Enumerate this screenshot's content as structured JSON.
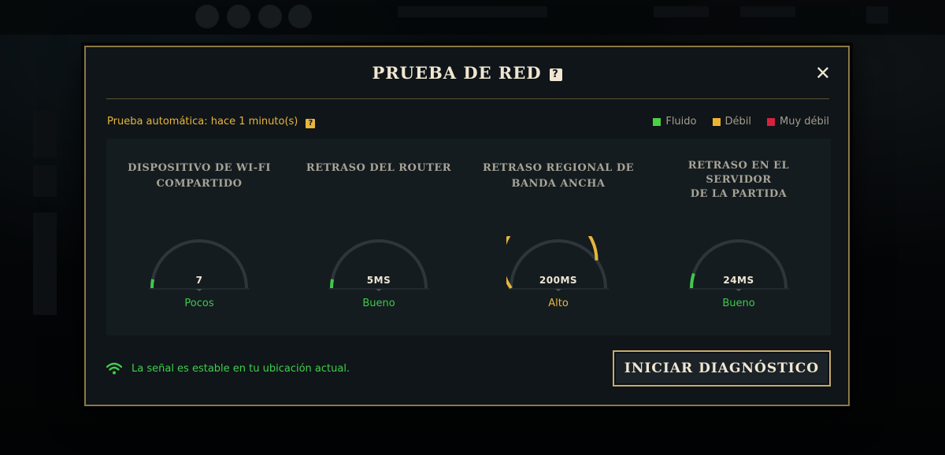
{
  "dialog": {
    "title": "PRUEBA DE RED",
    "help_glyph": "?",
    "close_glyph": "✕"
  },
  "auto_test": {
    "text": "Prueba automática: hace 1 minuto(s)",
    "help_glyph": "?"
  },
  "legend": [
    {
      "label": "Fluido",
      "color": "#4bd142"
    },
    {
      "label": "Débil",
      "color": "#f0b232"
    },
    {
      "label": "Muy débil",
      "color": "#d8213f"
    }
  ],
  "metrics": [
    {
      "label_line1": "DISPOSITIVO DE WI-FI",
      "label_line2": "COMPARTIDO",
      "value": "7",
      "status": "Pocos",
      "level": 0.06,
      "color": "#3ec94a"
    },
    {
      "label_line1": "RETRASO DEL ROUTER",
      "label_line2": "",
      "value": "5MS",
      "status": "Bueno",
      "level": 0.06,
      "color": "#3ec94a"
    },
    {
      "label_line1": "RETRASO REGIONAL DE",
      "label_line2": "BANDA ANCHA",
      "value": "200MS",
      "status": "Alto",
      "level": 0.8,
      "color": "#e8b53c"
    },
    {
      "label_line1": "RETRASO EN EL SERVIDOR",
      "label_line2": "DE LA PARTIDA",
      "value": "24MS",
      "status": "Bueno",
      "level": 0.1,
      "color": "#3ec94a"
    }
  ],
  "signal": {
    "icon": "wifi-icon",
    "text": "La señal es estable en tu ubicación actual.",
    "color": "#3fcf4a"
  },
  "diagnose_button": {
    "label": "INICIAR DIAGNÓSTICO"
  }
}
